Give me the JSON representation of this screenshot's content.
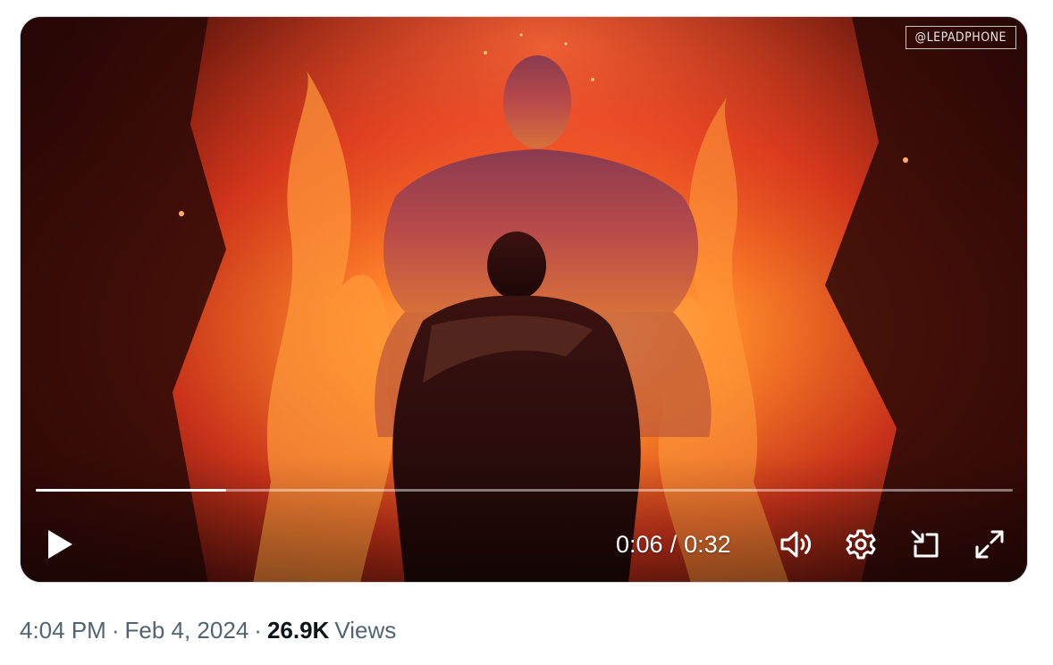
{
  "video": {
    "watermark": "@LEPADPHONE",
    "progress_fraction": 0.195,
    "current_time": "0:06",
    "separator": "/",
    "duration": "0:32"
  },
  "icons": {
    "play": "play-icon",
    "volume": "volume-icon",
    "settings": "gear-icon",
    "popout": "picture-in-picture-icon",
    "fullscreen": "fullscreen-icon"
  },
  "tweet_meta": {
    "time": "4:04 PM",
    "date": "Feb 4, 2024",
    "views_count": "26.9K",
    "views_label": "Views",
    "dot": "·"
  },
  "colors": {
    "meta_text": "#536471",
    "meta_strong": "#0f1419",
    "card_border": "#cfd9de"
  }
}
